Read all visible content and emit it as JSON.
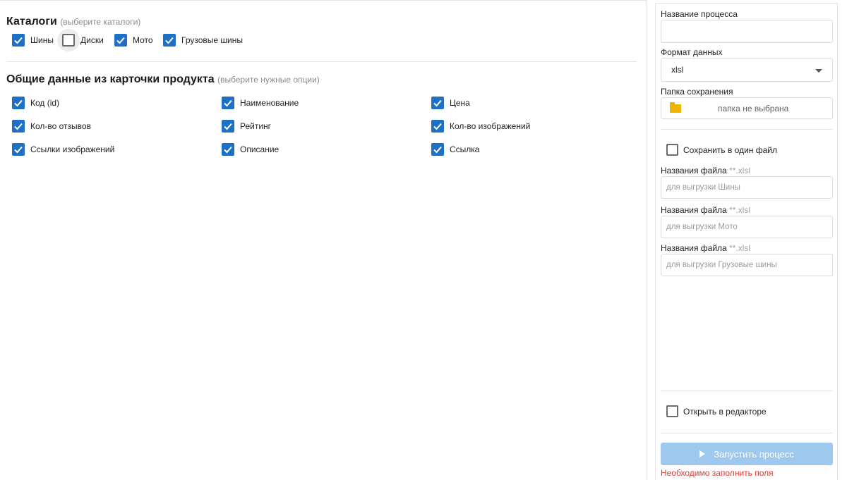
{
  "catalogs": {
    "title": "Каталоги",
    "hint": "(выберите каталоги)",
    "items": [
      {
        "label": "Шины",
        "checked": true
      },
      {
        "label": "Диски",
        "checked": false
      },
      {
        "label": "Мото",
        "checked": true
      },
      {
        "label": "Грузовые шины",
        "checked": true
      }
    ]
  },
  "product": {
    "title": "Общие данные из карточки продукта",
    "hint": "(выберите нужные опции)",
    "options": [
      {
        "label": "Код (id)",
        "checked": true
      },
      {
        "label": "Наименование",
        "checked": true
      },
      {
        "label": "Цена",
        "checked": true
      },
      {
        "label": "Кол-во отзывов",
        "checked": true
      },
      {
        "label": "Рейтинг",
        "checked": true
      },
      {
        "label": "Кол-во изображений",
        "checked": true
      },
      {
        "label": "Ссылки изображений",
        "checked": true
      },
      {
        "label": "Описание",
        "checked": true
      },
      {
        "label": "Ссылка",
        "checked": true
      }
    ]
  },
  "sidebar": {
    "process_name_label": "Название процесса",
    "process_name_value": "",
    "format_label": "Формат данных",
    "format_value": "xlsl",
    "folder_label": "Папка сохранения",
    "folder_value": "папка не выбрана",
    "save_one_file_label": "Сохранить в один файл",
    "save_one_file_checked": false,
    "file_names": [
      {
        "label": "Названия файла",
        "suffix": "**.xlsl",
        "placeholder": "для выгрузки  Шины"
      },
      {
        "label": "Названия файла",
        "suffix": "**.xlsl",
        "placeholder": "для выгрузки  Мото"
      },
      {
        "label": "Названия файла",
        "suffix": "**.xlsl",
        "placeholder": "для выгрузки  Грузовые шины"
      }
    ],
    "open_editor_label": "Открыть в редакторе",
    "open_editor_checked": false,
    "run_label": "Запустить процесс",
    "error_text": "Необходимо заполнить поля"
  },
  "colors": {
    "accent": "#1e6fc6",
    "button_disabled": "#9ec8ee",
    "error": "#e53935",
    "folder": "#f0b400"
  }
}
